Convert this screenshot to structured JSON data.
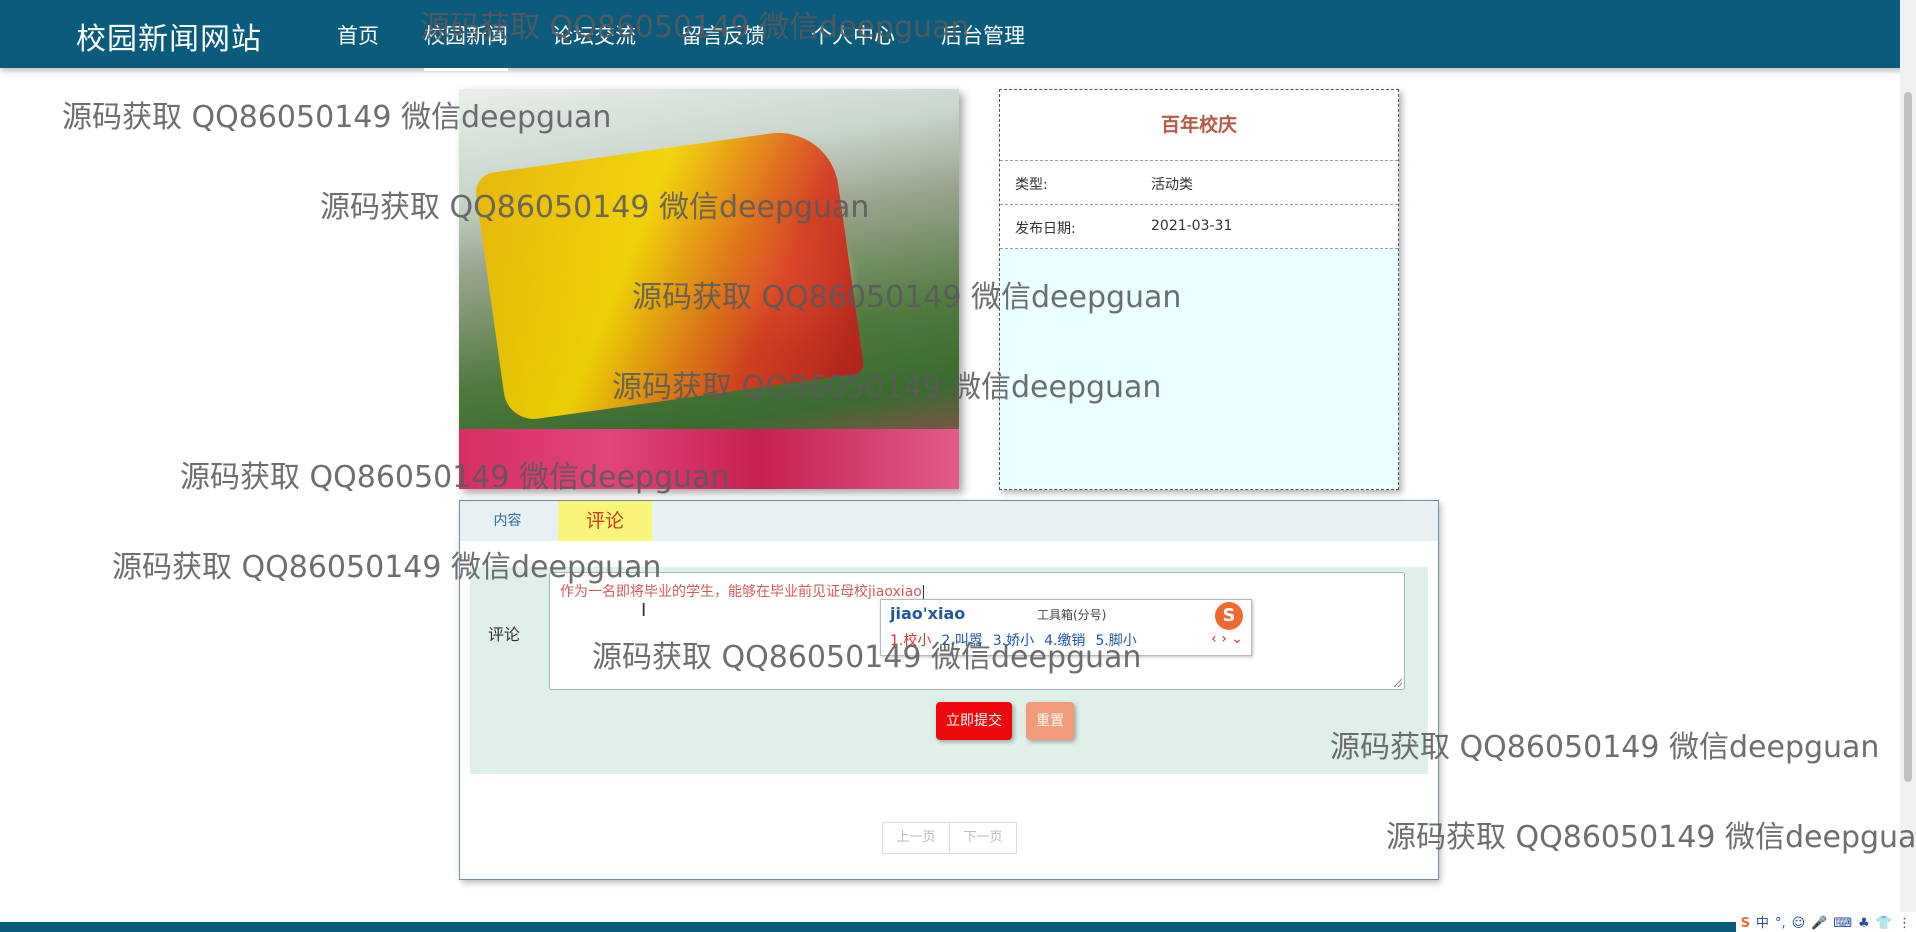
{
  "brand": "校园新闻网站",
  "nav": [
    {
      "label": "首页",
      "active": false
    },
    {
      "label": "校园新闻",
      "active": true
    },
    {
      "label": "论坛交流",
      "active": false
    },
    {
      "label": "留言反馈",
      "active": false
    },
    {
      "label": "个人中心",
      "active": false
    },
    {
      "label": "后台管理",
      "active": false
    }
  ],
  "news": {
    "title": "百年校庆",
    "type_label": "类型:",
    "type_value": "活动类",
    "date_label": "发布日期:",
    "date_value": "2021-03-31"
  },
  "tabs": {
    "content": "内容",
    "comment": "评论"
  },
  "form": {
    "label": "评论",
    "text": "作为一名即将毕业的学生，能够在毕业前见证母校jiaoxiao",
    "submit": "立即提交",
    "reset": "重置"
  },
  "pager": {
    "prev": "上一页",
    "next": "下一页"
  },
  "ime": {
    "pinyin": "jiao'xiao",
    "toolbox": "工具箱(分号)",
    "logo": "S",
    "candidates": [
      "1.校小",
      "2.叫嚣",
      "3.娇小",
      "4.缴销",
      "5.脚小"
    ],
    "arrows": "‹ › ⌄"
  },
  "tray": [
    "S",
    "中",
    "°,",
    "☺",
    "🎤",
    "⌨",
    "♣",
    "👕",
    "⋮"
  ],
  "watermark": "源码获取 QQ86050149 微信deepguan",
  "colors": {
    "nav_bg": "#0a5b7c",
    "submit_bg": "#ee0a0a",
    "reset_bg": "#f29a7c",
    "tab_active_bg": "#f8f579",
    "title_color": "#b75a48"
  }
}
